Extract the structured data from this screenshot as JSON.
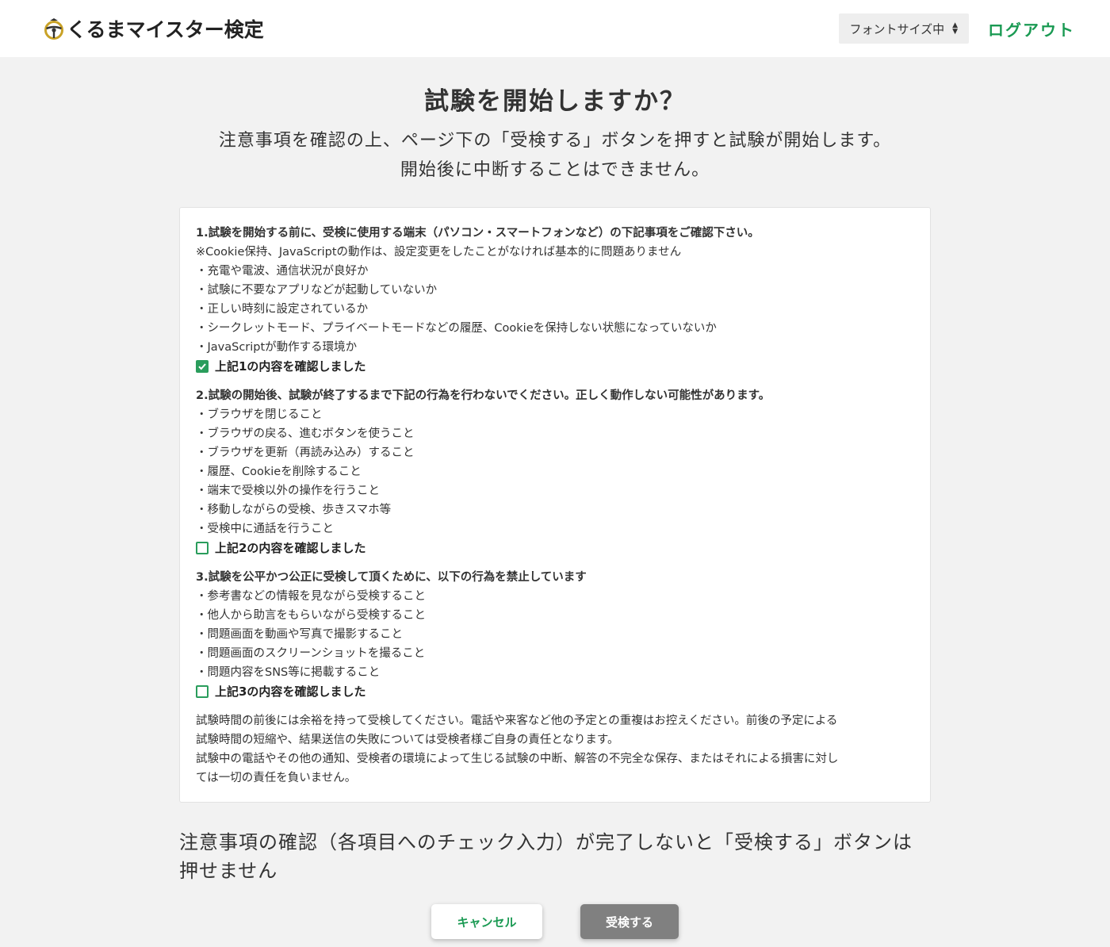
{
  "header": {
    "logo_text": "くるまマイスター検定",
    "font_size_select": "フォントサイズ中",
    "logout_label": "ログアウト"
  },
  "page": {
    "title": "試験を開始しますか？",
    "subtitle_line1": "注意事項を確認の上、ページ下の「受検する」ボタンを押すと試験が開始します。",
    "subtitle_line2": "開始後に中断することはできません。"
  },
  "sections": [
    {
      "heading": "1.試験を開始する前に、受検に使用する端末（パソコン・スマートフォンなど）の下記事項をご確認下さい。",
      "lines": [
        "※Cookie保持、JavaScriptの動作は、設定変更をしたことがなければ基本的に問題ありません",
        "・充電や電波、通信状況が良好か",
        "・試験に不要なアプリなどが起動していないか",
        "・正しい時刻に設定されているか",
        "・シークレットモード、プライベートモードなどの履歴、Cookieを保持しない状態になっていないか",
        "・JavaScriptが動作する環境か"
      ],
      "check_label": "上記1の内容を確認しました",
      "checked": true
    },
    {
      "heading": "2.試験の開始後、試験が終了するまで下記の行為を行わないでください。正しく動作しない可能性があります。",
      "lines": [
        "・ブラウザを閉じること",
        "・ブラウザの戻る、進むボタンを使うこと",
        "・ブラウザを更新（再読み込み）すること",
        "・履歴、Cookieを削除すること",
        "・端末で受検以外の操作を行うこと",
        "・移動しながらの受検、歩きスマホ等",
        "・受検中に通話を行うこと"
      ],
      "check_label": "上記2の内容を確認しました",
      "checked": false
    },
    {
      "heading": "3.試験を公平かつ公正に受検して頂くために、以下の行為を禁止しています",
      "lines": [
        "・参考書などの情報を見ながら受検すること",
        "・他人から助言をもらいながら受検すること",
        "・問題画面を動画や写真で撮影すること",
        "・問題画面のスクリーンショットを撮ること",
        "・問題内容をSNS等に掲載すること"
      ],
      "check_label": "上記3の内容を確認しました",
      "checked": false
    }
  ],
  "notice_lines": [
    "試験時間の前後には余裕を持って受検してください。電話や来客など他の予定との重複はお控えください。前後の予定による",
    "試験時間の短縮や、結果送信の失敗については受検者様ご自身の責任となります。",
    "試験中の電話やその他の通知、受検者の環境によって生じる試験の中断、解答の不完全な保存、またはそれによる損害に対し",
    "ては一切の責任を負いません。"
  ],
  "warning_text": "注意事項の確認（各項目へのチェック入力）が完了しないと「受検する」ボタンは押せません",
  "buttons": {
    "cancel_label": "キャンセル",
    "start_label": "受検する"
  },
  "colors": {
    "accent": "#1a9a53",
    "checkbox": "#2a9d5c",
    "background": "#f2f2f2",
    "disabled_button": "#808080"
  }
}
